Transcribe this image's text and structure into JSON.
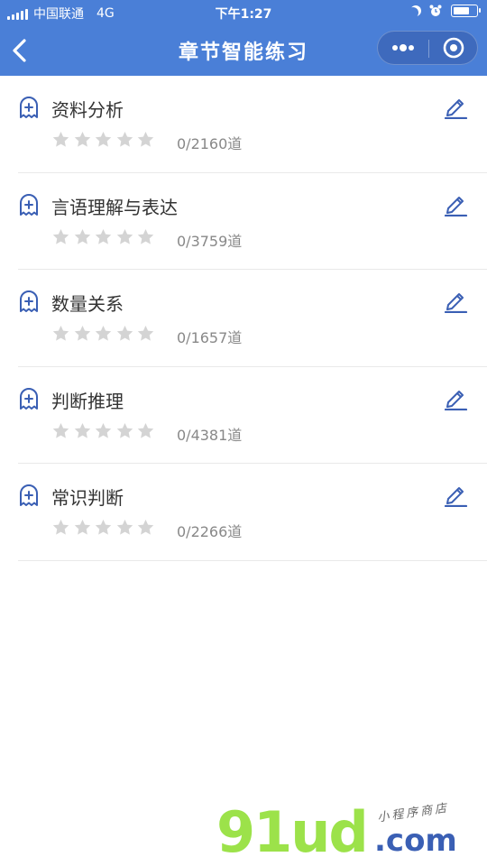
{
  "status_bar": {
    "carrier": "中国联通",
    "network": "4G",
    "time": "下午1:27"
  },
  "nav": {
    "title": "章节智能练习"
  },
  "theme": {
    "header_bg": "#4a7fd7",
    "accent": "#3a5fb4",
    "star_empty": "#d4d4d4"
  },
  "chapters": [
    {
      "title": "资料分析",
      "count": "0/2160道",
      "rating": 0,
      "max_rating": 5
    },
    {
      "title": "言语理解与表达",
      "count": "0/3759道",
      "rating": 0,
      "max_rating": 5
    },
    {
      "title": "数量关系",
      "count": "0/1657道",
      "rating": 0,
      "max_rating": 5
    },
    {
      "title": "判断推理",
      "count": "0/4381道",
      "rating": 0,
      "max_rating": 5
    },
    {
      "title": "常识判断",
      "count": "0/2266道",
      "rating": 0,
      "max_rating": 5
    }
  ],
  "watermark": {
    "brand": "91ud",
    "domain": ".com",
    "tagline": "小程序商店"
  }
}
